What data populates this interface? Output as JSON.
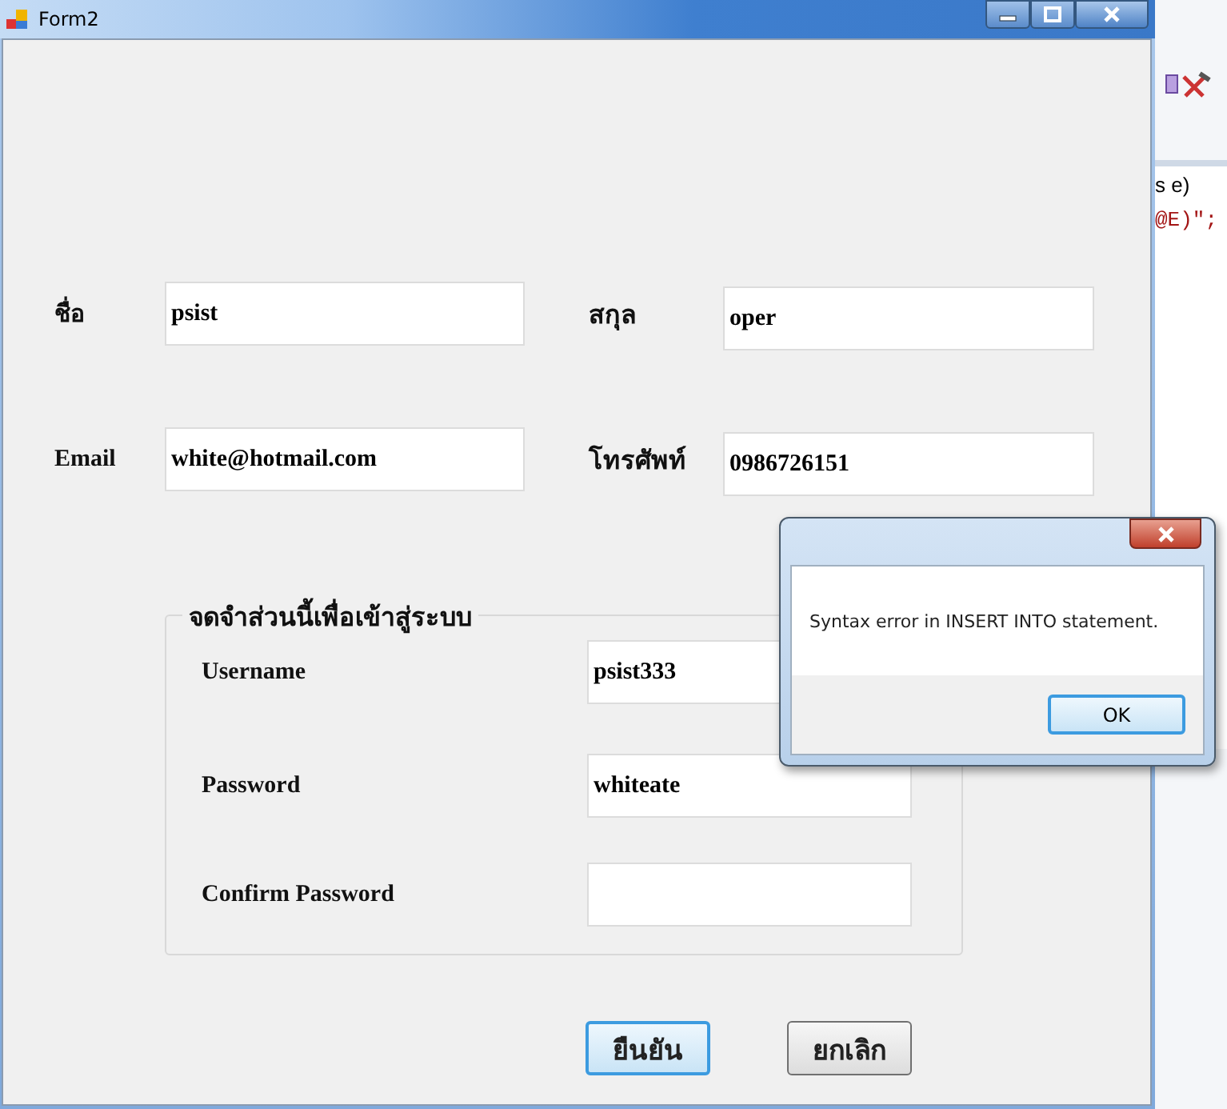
{
  "window": {
    "title": "Form2"
  },
  "fields": [
    {
      "label": "ชื่อ",
      "value": "psist"
    },
    {
      "label": "สกุล",
      "value": "oper"
    },
    {
      "label": "Email",
      "value": "white@hotmail.com"
    },
    {
      "label": "โทรศัพท์",
      "value": "0986726151"
    }
  ],
  "login_group": {
    "title": "จดจำส่วนนี้เพื่อเข้าสู่ระบบ",
    "fields": [
      {
        "label": "Username",
        "value": "psist333"
      },
      {
        "label": "Password",
        "value": "whiteate"
      },
      {
        "label": "Confirm Password"
      }
    ]
  },
  "buttons": [
    {
      "label": "ยืนยัน",
      "default": true
    },
    {
      "label": "ยกเลิก",
      "default": false
    }
  ],
  "message_box": {
    "message": "Syntax error in INSERT INTO statement.",
    "button": "OK"
  },
  "background_code": [
    "s e)",
    "@E)\";"
  ]
}
